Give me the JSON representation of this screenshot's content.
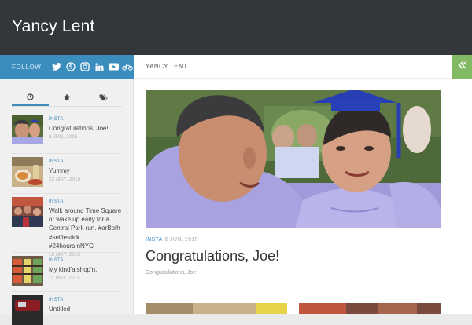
{
  "header": {
    "site_title": "Yancy Lent"
  },
  "follow": {
    "label": "FOLLOW:",
    "icons": [
      "twitter-icon",
      "skype-icon",
      "instagram-icon",
      "linkedin-icon",
      "youtube-icon",
      "bicycle-icon"
    ]
  },
  "sidebar": {
    "tabs": [
      {
        "icon": "clock-icon",
        "active": true
      },
      {
        "icon": "star-icon",
        "active": false
      },
      {
        "icon": "tags-icon",
        "active": false
      }
    ],
    "posts": [
      {
        "category": "INSTA",
        "title": "Congratulations, Joe!",
        "date": "6 JUN, 2015"
      },
      {
        "category": "INSTA",
        "title": "Yummy",
        "date": "23 MAY, 2015"
      },
      {
        "category": "INSTA",
        "title": "Walk around Time Square or wake up early for a Central Park run. #orBoth #selfiestick #24hoursInNYC",
        "date": "18 MAY, 2015"
      },
      {
        "category": "INSTA",
        "title": "My kind'a shop'n.",
        "date": "11 MAY, 2015"
      },
      {
        "category": "INSTA",
        "title": "Untitled",
        "date": ""
      }
    ]
  },
  "breadcrumb": {
    "label": "YANCY LENT"
  },
  "article": {
    "category": "INSTA",
    "date": "6 JUN, 2015",
    "title": "Congratulations, Joe!",
    "excerpt": "Congratulations, Joe!"
  },
  "colors": {
    "header_bg": "#33363b",
    "accent_blue": "#3b8dbd",
    "accent_green": "#82b965"
  }
}
